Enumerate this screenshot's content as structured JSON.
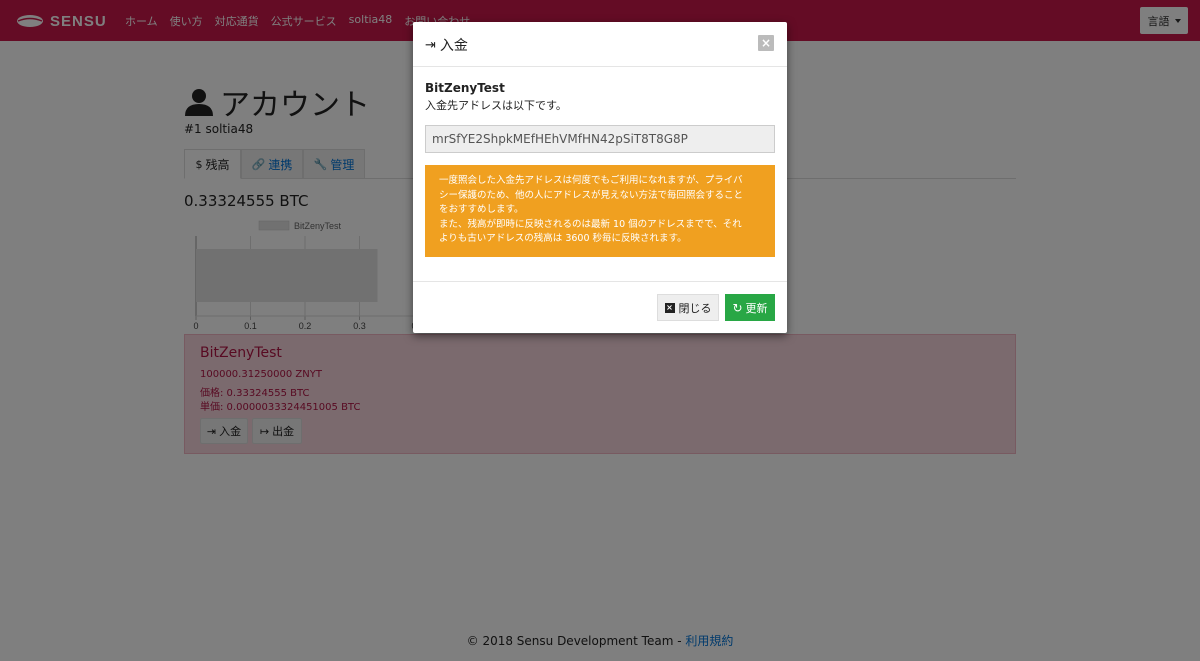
{
  "navbar": {
    "brand": "SENSU",
    "items": [
      "ホーム",
      "使い方",
      "対応通貨",
      "公式サービス",
      "soltia48",
      "お問い合わせ"
    ],
    "language_button": "言語"
  },
  "page": {
    "title": "アカウント",
    "account_id": "#1 soltia48",
    "tabs": [
      {
        "label": "残高",
        "icon": "dollar-icon"
      },
      {
        "label": "連携",
        "icon": "link-icon"
      },
      {
        "label": "管理",
        "icon": "wrench-icon"
      }
    ],
    "total_balance": "0.33324555 BTC"
  },
  "chart_data": {
    "type": "bar",
    "orientation": "horizontal",
    "categories": [
      ""
    ],
    "series": [
      {
        "name": "BitZenyTest",
        "values": [
          0.333
        ]
      }
    ],
    "xlim": [
      0,
      0.4
    ],
    "xticks": [
      "0",
      "0.1",
      "0.2",
      "0.3",
      "0"
    ],
    "legend": "top",
    "grid": true,
    "colors": {
      "bar": "#e3e3e3",
      "legend_box": "#e3e3e3"
    }
  },
  "coin_card": {
    "name": "BitZenyTest",
    "amount": "100000.31250000 ZNYT",
    "price": "価格: 0.33324555 BTC",
    "unit_price": "単価: 0.0000033324451005 BTC",
    "deposit_button": "入金",
    "withdraw_button": "出金"
  },
  "footer": {
    "text": "© 2018 Sensu Development Team - ",
    "link": "利用規約"
  },
  "modal": {
    "title": "入金",
    "coin_name": "BitZenyTest",
    "description": "入金先アドレスは以下です。",
    "address": "mrSfYE2ShpkMEfHEhVMfHN42pSiT8T8G8P",
    "alert_lines": [
      "一度照会した入金先アドレスは何度でもご利用になれますが、プライバ",
      "シー保護のため、他の人にアドレスが見えない方法で毎回照会すること",
      "をおすすめします。",
      "また、残高が即時に反映されるのは最新 10 個のアドレスまでで、それ",
      "よりも古いアドレスの残高は 3600 秒毎に反映されます。"
    ],
    "close_button": "閉じる",
    "refresh_button": "更新"
  },
  "colors": {
    "navbar": "#c8184a",
    "alert": "#f0a020",
    "success": "#28a745",
    "link": "#0275d8",
    "coin_card_bg": "#f6d5dd",
    "coin_text": "#b01545"
  }
}
